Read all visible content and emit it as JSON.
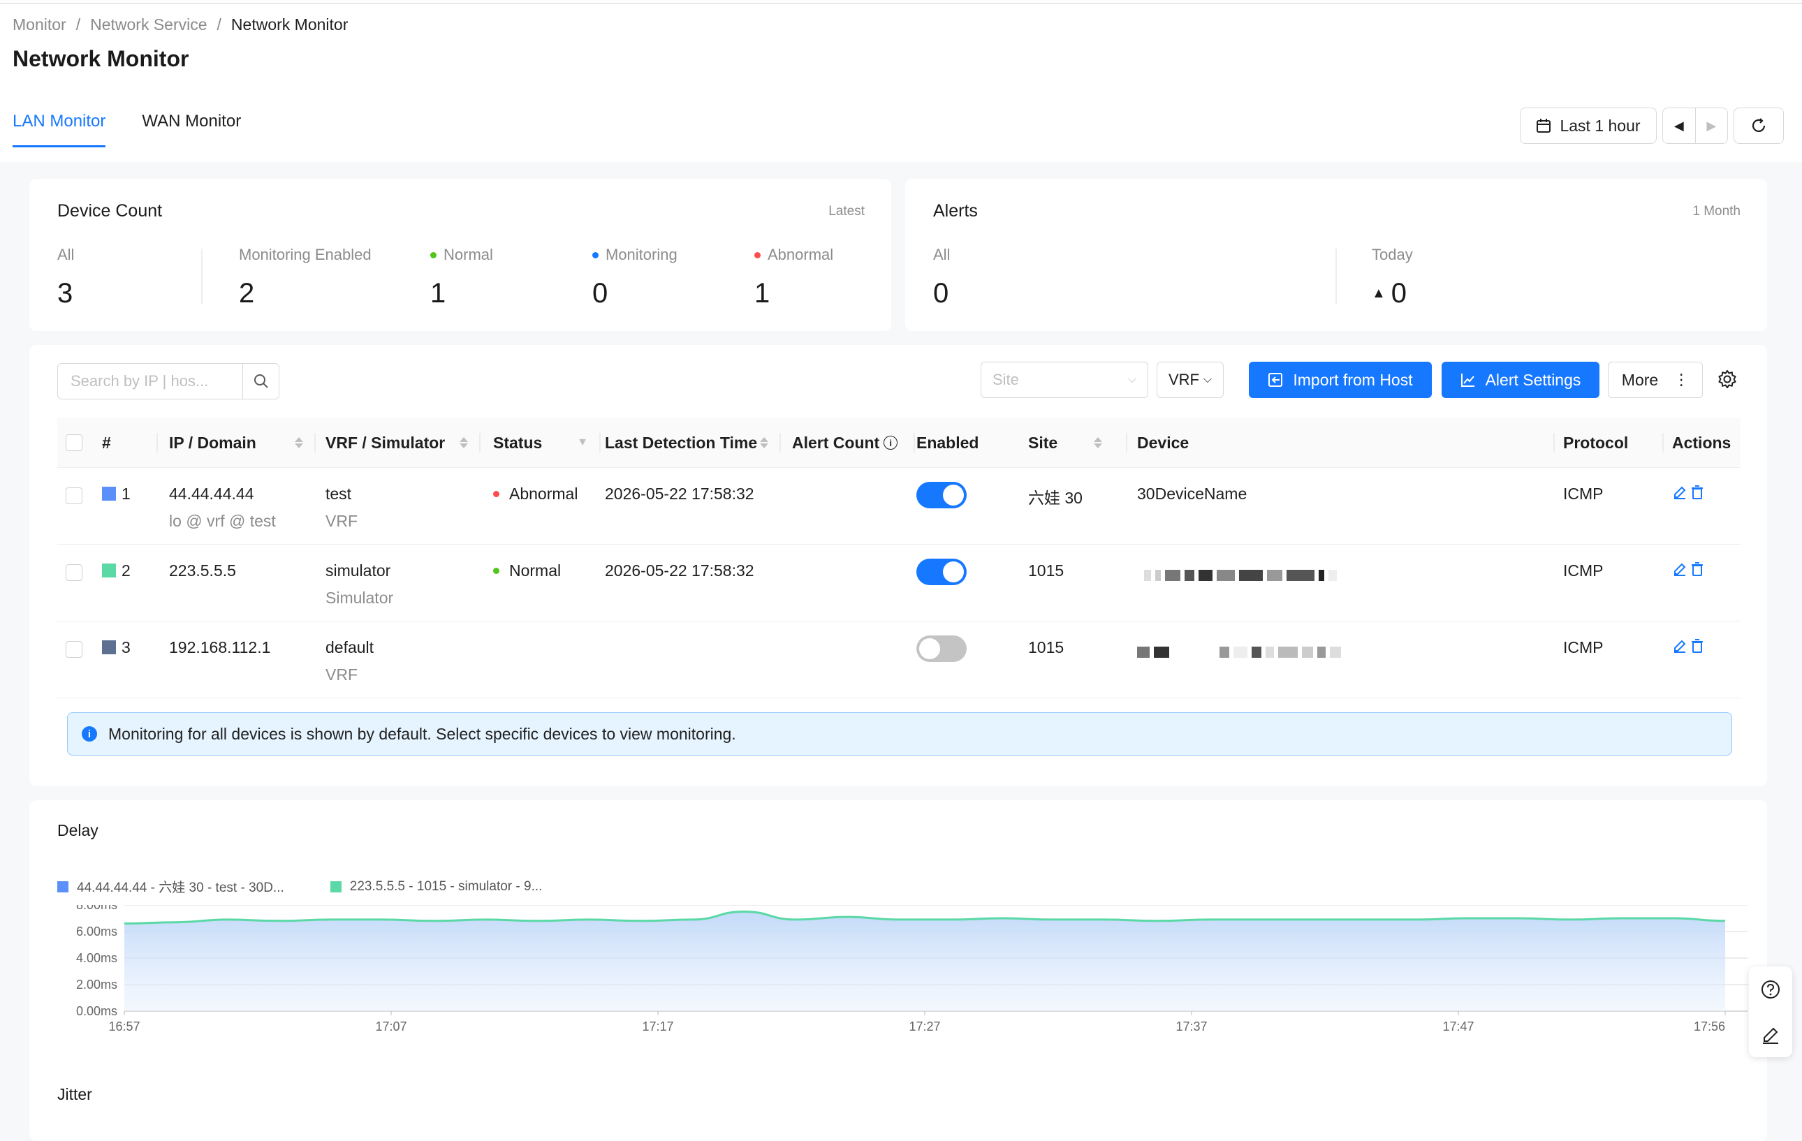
{
  "breadcrumb": [
    "Monitor",
    "/",
    "Network Service",
    "/",
    "Network Monitor"
  ],
  "page_title": "Network Monitor",
  "tabs": [
    {
      "label": "LAN Monitor",
      "active": true
    },
    {
      "label": "WAN Monitor",
      "active": false
    }
  ],
  "time_range": {
    "label": "Last 1 hour"
  },
  "device_count": {
    "title": "Device Count",
    "hint": "Latest",
    "stats": [
      {
        "label": "All",
        "value": "3"
      },
      {
        "label": "Monitoring Enabled",
        "value": "2"
      },
      {
        "label": "Normal",
        "value": "1",
        "dot": "#52c41a"
      },
      {
        "label": "Monitoring",
        "value": "0",
        "dot": "#1677ff"
      },
      {
        "label": "Abnormal",
        "value": "1",
        "dot": "#ff4d4f"
      }
    ]
  },
  "alerts": {
    "title": "Alerts",
    "hint": "1 Month",
    "stats": [
      {
        "label": "All",
        "value": "0"
      },
      {
        "label": "Today",
        "value": "0"
      }
    ]
  },
  "filters": {
    "search_placeholder": "Search by IP | hos...",
    "site_placeholder": "Site",
    "vrf_label": "VRF",
    "import_label": "Import from Host",
    "alert_settings_label": "Alert Settings",
    "more_label": "More"
  },
  "table": {
    "columns": [
      "#",
      "IP / Domain",
      "VRF / Simulator",
      "Status",
      "Last Detection Time",
      "Alert Count",
      "Enabled",
      "Site",
      "Device",
      "Protocol",
      "Actions"
    ],
    "rows": [
      {
        "num": "1",
        "color": "#5b8ff9",
        "ip": "44.44.44.44",
        "ip_sub": "lo @ vrf @ test",
        "vrf": "test",
        "vrf_sub": "VRF",
        "status": "Abnormal",
        "status_color": "#ff4d4f",
        "time": "2026-05-22 17:58:32",
        "enabled": true,
        "site": "六娃 30",
        "device": "30DeviceName",
        "protocol": "ICMP"
      },
      {
        "num": "2",
        "color": "#5ad8a6",
        "ip": "223.5.5.5",
        "ip_sub": "",
        "vrf": "simulator",
        "vrf_sub": "Simulator",
        "status": "Normal",
        "status_color": "#52c41a",
        "time": "2026-05-22 17:58:32",
        "enabled": true,
        "site": "1015",
        "device": "",
        "protocol": "ICMP"
      },
      {
        "num": "3",
        "color": "#5d7092",
        "ip": "192.168.112.1",
        "ip_sub": "",
        "vrf": "default",
        "vrf_sub": "VRF",
        "status": "",
        "status_color": "",
        "time": "",
        "enabled": false,
        "site": "1015",
        "device": "",
        "protocol": "ICMP"
      }
    ]
  },
  "info_message": "Monitoring for all devices is shown by default. Select specific devices to view monitoring.",
  "delay_title": "Delay",
  "jitter_title": "Jitter",
  "chart_data": {
    "type": "area",
    "title": "Delay",
    "series": [
      {
        "name": "44.44.44.44 - 六娃 30 - test - 30D...",
        "color": "#5b8ff9",
        "values": []
      },
      {
        "name": "223.5.5.5 - 1015 - simulator - 9...",
        "color": "#5ad8a6",
        "values": [
          6.6,
          6.7,
          6.9,
          6.8,
          6.9,
          6.9,
          6.8,
          6.9,
          6.8,
          6.9,
          6.8,
          6.9,
          7.5,
          6.9,
          7.1,
          6.9,
          6.9,
          7.0,
          6.9,
          6.9,
          6.8,
          6.9,
          6.9,
          6.9,
          6.9,
          6.9,
          7.0,
          7.0,
          6.9,
          7.0,
          7.0,
          6.8
        ]
      }
    ],
    "x_ticks": [
      "16:57",
      "17:07",
      "17:17",
      "17:27",
      "17:37",
      "17:47",
      "17:56"
    ],
    "y_ticks": [
      "8.00ms",
      "6.00ms",
      "4.00ms",
      "2.00ms",
      "0.00ms"
    ],
    "ylim": [
      0,
      8
    ]
  }
}
